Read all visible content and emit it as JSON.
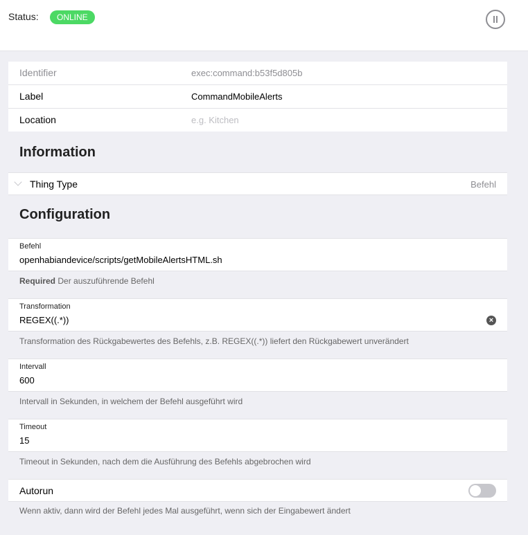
{
  "status": {
    "label": "Status:",
    "badge": "ONLINE"
  },
  "details": {
    "identifier_label": "Identifier",
    "identifier_value": "exec:command:b53f5d805b",
    "label_label": "Label",
    "label_value": "CommandMobileAlerts",
    "location_label": "Location",
    "location_placeholder": "e.g. Kitchen"
  },
  "information": {
    "title": "Information",
    "thing_type_label": "Thing Type",
    "thing_type_value": "Befehl"
  },
  "configuration": {
    "title": "Configuration",
    "befehl": {
      "label": "Befehl",
      "value": "openhabiandevice/scripts/getMobileAlertsHTML.sh",
      "help_required": "Required",
      "help": "Der auszuführende Befehl"
    },
    "transformation": {
      "label": "Transformation",
      "value": "REGEX((.*))",
      "help": "Transformation des Rückgabewertes des Befehls, z.B. REGEX((.*)) liefert den Rückgabewert unverändert"
    },
    "intervall": {
      "label": "Intervall",
      "value": "600",
      "help": "Intervall in Sekunden, in welchem der Befehl ausgeführt wird"
    },
    "timeout": {
      "label": "Timeout",
      "value": "15",
      "help": "Timeout in Sekunden, nach dem die Ausführung des Befehls abgebrochen wird"
    },
    "autorun": {
      "label": "Autorun",
      "enabled": false,
      "help": "Wenn aktiv, dann wird der Befehl jedes Mal ausgeführt, wenn sich der Eingabewert ändert"
    }
  }
}
